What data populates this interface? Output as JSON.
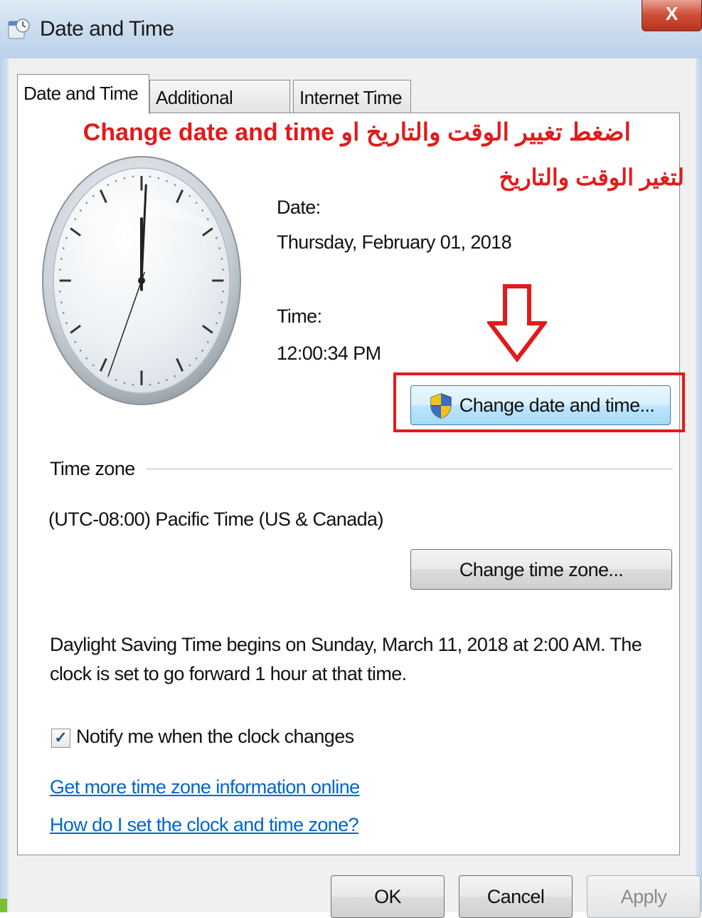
{
  "window": {
    "title": "Date and Time",
    "close_label": "X"
  },
  "tabs": [
    {
      "label": "Date and Time",
      "active": true
    },
    {
      "label": "Additional Clocks",
      "active": false
    },
    {
      "label": "Internet Time",
      "active": false
    }
  ],
  "annotation": {
    "line1": "اضغط تغيير الوقت والتاريخ او Change date and time",
    "line2": "لتغير الوقت والتاريخ",
    "color": "#e11b1b"
  },
  "clock": {
    "hour": 12,
    "minute": 0,
    "second": 34
  },
  "date_section": {
    "date_label": "Date:",
    "date_value": "Thursday, February 01, 2018",
    "time_label": "Time:",
    "time_value": "12:00:34 PM",
    "change_button": "Change date and time..."
  },
  "timezone_section": {
    "group_label": "Time zone",
    "value": "(UTC-08:00) Pacific Time (US & Canada)",
    "change_button": "Change time zone..."
  },
  "dst": {
    "line1": "Daylight Saving Time begins on Sunday, March 11, 2018 at 2:00 AM. The",
    "line2": "clock is set to go forward 1 hour at that time."
  },
  "notify": {
    "label": "Notify me when the clock changes",
    "checked": true
  },
  "links": {
    "more_info": "Get more time zone information online",
    "how_to": "How do I set the clock and time zone?"
  },
  "footer": {
    "ok": "OK",
    "cancel": "Cancel",
    "apply": "Apply"
  },
  "icons": {
    "window_icon": "clock-calendar-icon",
    "shield": "uac-shield-icon",
    "arrow": "down-arrow-icon"
  }
}
